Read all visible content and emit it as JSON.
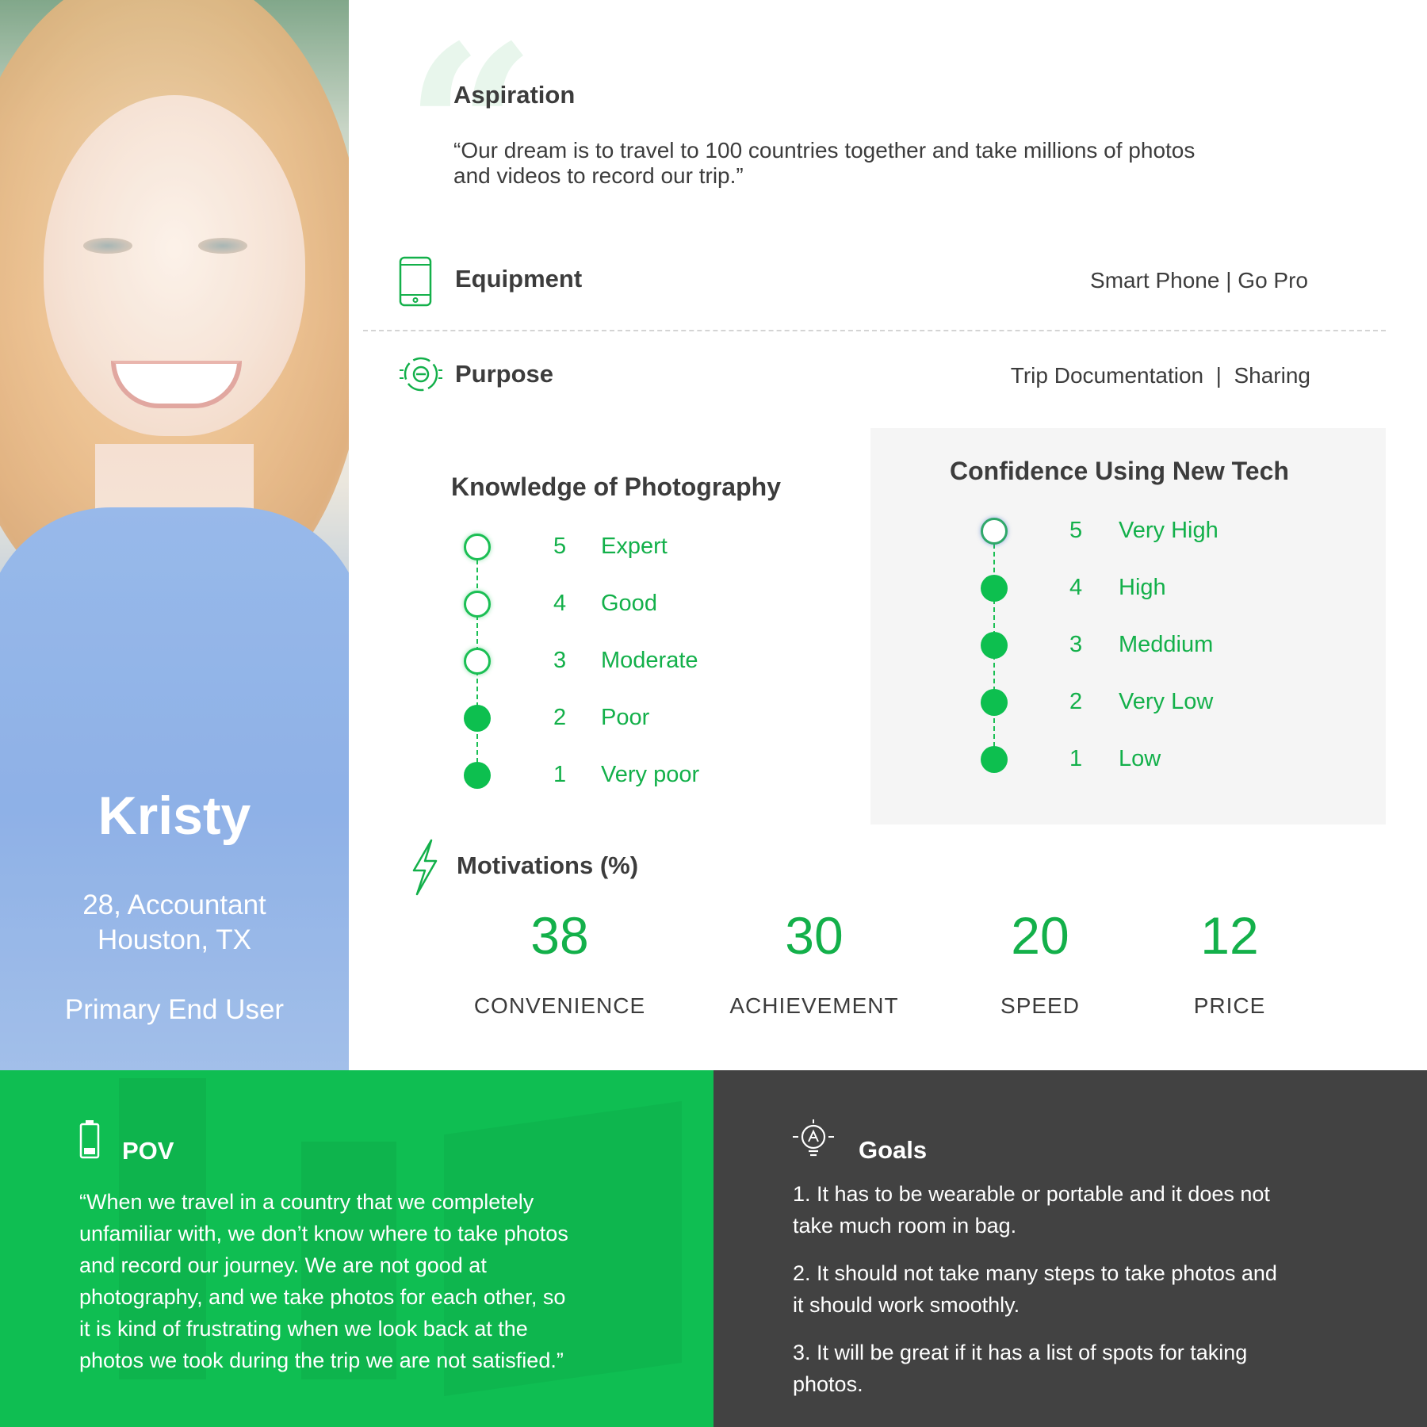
{
  "persona": {
    "name": "Kristy",
    "age_job": "28, Accountant",
    "location": "Houston, TX",
    "role": "Primary End User"
  },
  "aspiration": {
    "title": "Aspiration",
    "quote_line1": "“Our dream is to travel to 100 countries together and take millions of photos",
    "quote_line2": "and videos to record our trip.”"
  },
  "equipment": {
    "title": "Equipment",
    "value": "Smart Phone | Go Pro",
    "icon": "smartphone-icon"
  },
  "purpose": {
    "title": "Purpose",
    "value": "Trip Documentation  |  Sharing",
    "icon": "target-icon"
  },
  "knowledge": {
    "title": "Knowledge of Photography",
    "levels": [
      {
        "num": "5",
        "label": "Expert",
        "filled": false
      },
      {
        "num": "4",
        "label": "Good",
        "filled": false
      },
      {
        "num": "3",
        "label": "Moderate",
        "filled": false
      },
      {
        "num": "2",
        "label": "Poor",
        "filled": true
      },
      {
        "num": "1",
        "label": "Very poor",
        "filled": true
      }
    ]
  },
  "confidence": {
    "title": "Confidence Using New Tech",
    "levels": [
      {
        "num": "5",
        "label": "Very High",
        "filled": false
      },
      {
        "num": "4",
        "label": "High",
        "filled": true
      },
      {
        "num": "3",
        "label": "Meddium",
        "filled": true
      },
      {
        "num": "2",
        "label": "Very Low",
        "filled": true
      },
      {
        "num": "1",
        "label": "Low",
        "filled": true
      }
    ]
  },
  "motivations": {
    "title": "Motivations (%)",
    "icon": "lightning-icon",
    "items": [
      {
        "value": "38",
        "label": "CONVENIENCE"
      },
      {
        "value": "30",
        "label": "ACHIEVEMENT"
      },
      {
        "value": "20",
        "label": "SPEED"
      },
      {
        "value": "12",
        "label": "PRICE"
      }
    ]
  },
  "pov": {
    "title": "POV",
    "icon": "battery-icon",
    "lines": [
      "“When we travel in a country that we completely",
      "unfamiliar with, we don’t know where to take photos",
      "and record our journey. We are not good at",
      "photography, and we take photos for each other, so",
      "it is kind of frustrating when we look back at the",
      "photos we took during the trip we are not satisfied.”"
    ]
  },
  "goals": {
    "title": "Goals",
    "icon": "lightbulb-icon",
    "items": [
      {
        "line1": "1. It has to be wearable or portable and it does not",
        "line2": "take much room in bag."
      },
      {
        "line1": "2. It should not take many steps to take photos and",
        "line2": "it should work smoothly."
      },
      {
        "line1": "3. It will be great if it has a list of spots for taking",
        "line2": "photos."
      }
    ]
  },
  "colors": {
    "accent": "#0fbe52",
    "dark_panel": "#424242",
    "text": "#3c3c3c"
  }
}
